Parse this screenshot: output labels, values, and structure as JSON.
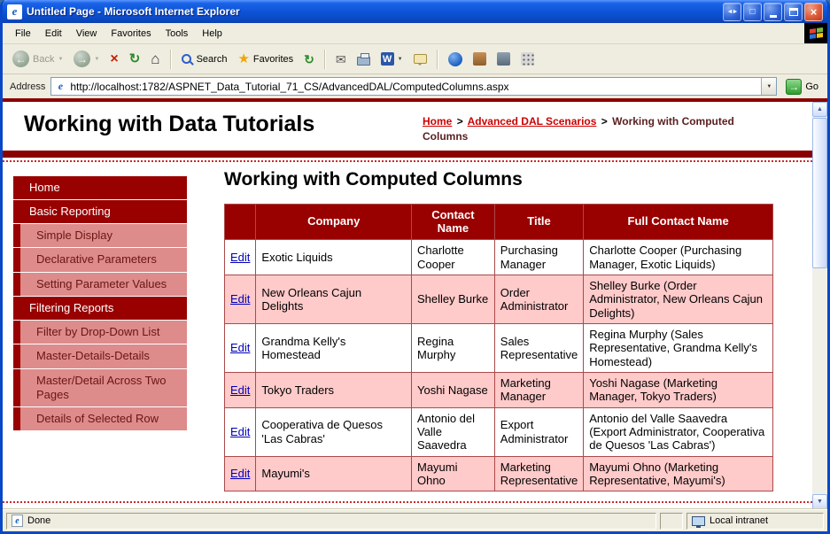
{
  "window": {
    "title": "Untitled Page - Microsoft Internet Explorer",
    "status": {
      "left": "Done",
      "right": "Local intranet"
    }
  },
  "menu": {
    "items": [
      "File",
      "Edit",
      "View",
      "Favorites",
      "Tools",
      "Help"
    ]
  },
  "toolbar": {
    "back_label": "Back",
    "search_label": "Search",
    "favorites_label": "Favorites"
  },
  "address": {
    "label": "Address",
    "url": "http://localhost:1782/ASPNET_Data_Tutorial_71_CS/AdvancedDAL/ComputedColumns.aspx",
    "go_label": "Go"
  },
  "header": {
    "site_title": "Working with Data Tutorials",
    "breadcrumb": {
      "home": "Home",
      "separator": ">",
      "section": "Advanced DAL Scenarios",
      "current": "Working with Computed Columns"
    }
  },
  "sidebar": {
    "items": [
      {
        "label": "Home",
        "type": "header"
      },
      {
        "label": "Basic Reporting",
        "type": "header"
      },
      {
        "label": "Simple Display",
        "type": "link"
      },
      {
        "label": "Declarative Parameters",
        "type": "link"
      },
      {
        "label": "Setting Parameter Values",
        "type": "link"
      },
      {
        "label": "Filtering Reports",
        "type": "header"
      },
      {
        "label": "Filter by Drop-Down List",
        "type": "link"
      },
      {
        "label": "Master-Details-Details",
        "type": "link"
      },
      {
        "label": "Master/Detail Across Two Pages",
        "type": "link"
      },
      {
        "label": "Details of Selected Row",
        "type": "link"
      }
    ]
  },
  "main": {
    "heading": "Working with Computed Columns",
    "grid": {
      "edit_label": "Edit",
      "headers": [
        "",
        "Company",
        "Contact Name",
        "Title",
        "Full Contact Name"
      ],
      "rows": [
        {
          "company": "Exotic Liquids",
          "contact_name": "Charlotte Cooper",
          "title": "Purchasing Manager",
          "full_contact_name": "Charlotte Cooper (Purchasing Manager, Exotic Liquids)"
        },
        {
          "company": "New Orleans Cajun Delights",
          "contact_name": "Shelley Burke",
          "title": "Order Administrator",
          "full_contact_name": "Shelley Burke (Order Administrator, New Orleans Cajun Delights)"
        },
        {
          "company": "Grandma Kelly's Homestead",
          "contact_name": "Regina Murphy",
          "title": "Sales Representative",
          "full_contact_name": "Regina Murphy (Sales Representative, Grandma Kelly's Homestead)"
        },
        {
          "company": "Tokyo Traders",
          "contact_name": "Yoshi Nagase",
          "title": "Marketing Manager",
          "full_contact_name": "Yoshi Nagase (Marketing Manager, Tokyo Traders)"
        },
        {
          "company": "Cooperativa de Quesos 'Las Cabras'",
          "contact_name": "Antonio del Valle Saavedra",
          "title": "Export Administrator",
          "full_contact_name": "Antonio del Valle Saavedra (Export Administrator, Cooperativa de Quesos 'Las Cabras')"
        },
        {
          "company": "Mayumi's",
          "contact_name": "Mayumi Ohno",
          "title": "Marketing Representative",
          "full_contact_name": "Mayumi Ohno (Marketing Representative, Mayumi's)"
        }
      ]
    }
  },
  "icons": {
    "ie_e": "e",
    "pan": "◄►",
    "window_box": "□",
    "close": "×",
    "back_arrow": "←",
    "forward_arrow": "→",
    "stop_x": "×",
    "refresh": "↻",
    "home": "⌂",
    "star": "★",
    "mail": "✉",
    "word_w": "W",
    "dropdown": "▼",
    "up_arrow": "▲",
    "down_arrow": "▼",
    "go_arrow": "→"
  },
  "colors": {
    "maroon": "#990000",
    "band": "#8B0000",
    "pink_row": "#FFCACA",
    "sidebar_link_bg": "#DE8B8B",
    "edit_link_blue": "#0000BB",
    "breadcrumb_red": "#CC0000",
    "titlebar_blue": "#0D54D8"
  }
}
